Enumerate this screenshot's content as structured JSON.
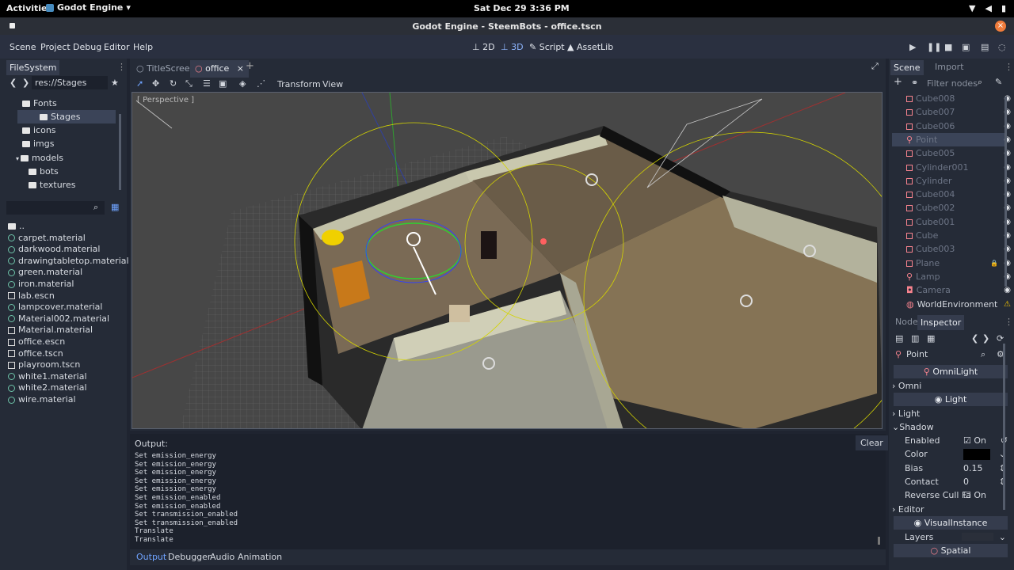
{
  "system_bar": {
    "activities": "Activities",
    "app_menu": "Godot Engine",
    "clock": "Sat Dec 29   3:36 PM"
  },
  "window": {
    "title": "Godot Engine - SteemBots - office.tscn"
  },
  "menu": {
    "items": [
      "Scene",
      "Project",
      "Debug",
      "Editor",
      "Help"
    ],
    "modes": [
      "2D",
      "3D",
      "Script",
      "AssetLib"
    ]
  },
  "filesystem": {
    "tab_label": "FileSystem",
    "path": "res://Stages",
    "tree": [
      {
        "label": "Fonts",
        "kind": "folder"
      },
      {
        "label": "Stages",
        "kind": "folder",
        "selected": true
      },
      {
        "label": "icons",
        "kind": "folder"
      },
      {
        "label": "imgs",
        "kind": "folder"
      },
      {
        "label": "models",
        "kind": "folder"
      },
      {
        "label": "bots",
        "kind": "folder"
      },
      {
        "label": "textures",
        "kind": "folder"
      }
    ],
    "files": [
      {
        "label": "..",
        "kind": "folder"
      },
      {
        "label": "carpet.material",
        "kind": "resource"
      },
      {
        "label": "darkwood.material",
        "kind": "resource"
      },
      {
        "label": "drawingtabletop.material",
        "kind": "resource"
      },
      {
        "label": "green.material",
        "kind": "resource"
      },
      {
        "label": "iron.material",
        "kind": "resource"
      },
      {
        "label": "lab.escn",
        "kind": "scene"
      },
      {
        "label": "lampcover.material",
        "kind": "resource"
      },
      {
        "label": "Material002.material",
        "kind": "resource"
      },
      {
        "label": "Material.material",
        "kind": "scene"
      },
      {
        "label": "office.escn",
        "kind": "scene"
      },
      {
        "label": "office.tscn",
        "kind": "scene"
      },
      {
        "label": "playroom.tscn",
        "kind": "scene"
      },
      {
        "label": "white1.material",
        "kind": "resource"
      },
      {
        "label": "white2.material",
        "kind": "resource"
      },
      {
        "label": "wire.material",
        "kind": "resource"
      }
    ]
  },
  "editor_tabs": [
    "TitleScreen",
    "office"
  ],
  "viewport_toolbar": {
    "transform": "Transform",
    "view": "View"
  },
  "viewport": {
    "perspective_label": "[ Perspective ]"
  },
  "output": {
    "label": "Output:",
    "clear": "Clear",
    "lines": [
      "Set emission_energy",
      "Set emission_energy",
      "Set emission_energy",
      "Set emission_energy",
      "Set emission_energy",
      "Set emission_enabled",
      "Set emission_enabled",
      "Set transmission_enabled",
      "Set transmission_enabled",
      "Translate",
      "Translate"
    ]
  },
  "bottom_tabs": [
    "Output",
    "Debugger",
    "Audio",
    "Animation"
  ],
  "scene_dock": {
    "tabs": [
      "Scene",
      "Import"
    ],
    "filter_placeholder": "Filter nodes",
    "nodes": [
      {
        "label": "Cube008",
        "icon": "mesh-icon"
      },
      {
        "label": "Cube007",
        "icon": "mesh-icon"
      },
      {
        "label": "Cube006",
        "icon": "mesh-icon"
      },
      {
        "label": "Point",
        "icon": "light-icon",
        "selected": true
      },
      {
        "label": "Cube005",
        "icon": "mesh-icon"
      },
      {
        "label": "Cylinder001",
        "icon": "mesh-icon"
      },
      {
        "label": "Cylinder",
        "icon": "mesh-icon"
      },
      {
        "label": "Cube004",
        "icon": "mesh-icon"
      },
      {
        "label": "Cube002",
        "icon": "mesh-icon"
      },
      {
        "label": "Cube001",
        "icon": "mesh-icon"
      },
      {
        "label": "Cube",
        "icon": "mesh-icon"
      },
      {
        "label": "Cube003",
        "icon": "mesh-icon"
      },
      {
        "label": "Plane",
        "icon": "mesh-icon"
      },
      {
        "label": "Lamp",
        "icon": "light-icon"
      },
      {
        "label": "Camera",
        "icon": "camera-icon"
      },
      {
        "label": "WorldEnvironment",
        "icon": "world-icon"
      }
    ]
  },
  "inspector": {
    "tabs": [
      "Node",
      "Inspector"
    ],
    "object": "Point",
    "sections": {
      "omnilight": "OmniLight",
      "omni": "Omni",
      "light_header": "Light",
      "light": "Light",
      "shadow": "Shadow",
      "editor": "Editor",
      "visual_instance": "VisualInstance",
      "spatial": "Spatial"
    },
    "props": {
      "enabled_label": "Enabled",
      "enabled_value": "On",
      "color_label": "Color",
      "color_value": "#000000",
      "bias_label": "Bias",
      "bias_value": "0.15",
      "contact_label": "Contact",
      "contact_value": "0",
      "reverse_label": "Reverse Cull Fa",
      "reverse_value": "On",
      "layers_label": "Layers"
    }
  }
}
